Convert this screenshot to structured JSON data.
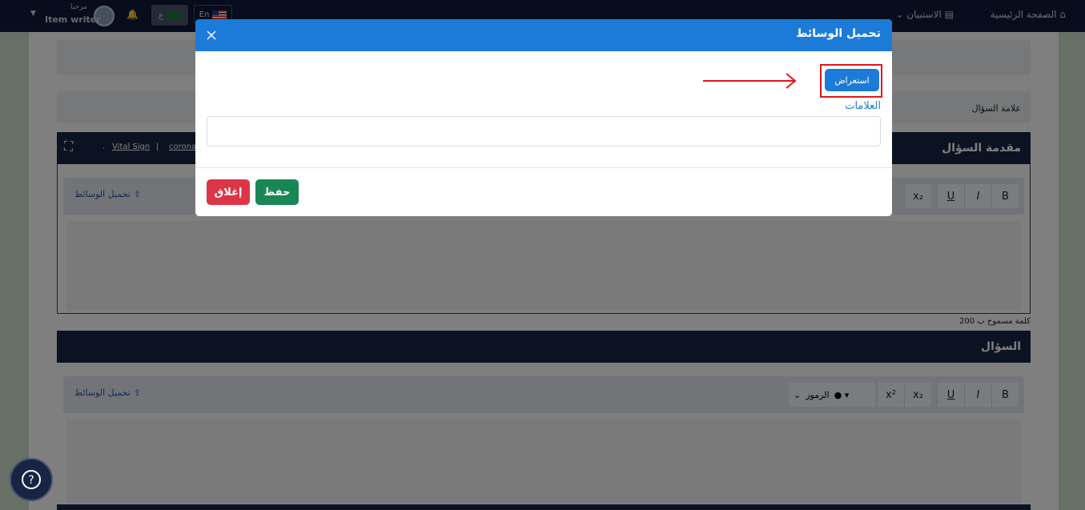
{
  "topbar": {
    "home_label": "الصفحة الرئيسية",
    "surveys_label": "الاستبيان",
    "lang_en": "En",
    "lang_ar": "ع",
    "greeting": "مرحبا",
    "user_name": "Item writer"
  },
  "page": {
    "question_mark_label": "علامة السؤال",
    "intro_panel_title": "مقدمة السؤال",
    "intro_links": [
      "Vital Sign",
      "corona"
    ],
    "intro_link_separator": "|",
    "intro_dot": ".",
    "upload_media_label": "تحميل الوسائط",
    "word_limit_text": "200 كلمة مسموح ب",
    "question_panel_title": "السؤال",
    "symbols_label": "الرموز",
    "toolbar_buttons": [
      "B",
      "I",
      "U",
      "x₂",
      "x²"
    ]
  },
  "modal": {
    "title": "تحميل الوسائط",
    "preview_button": "استعراض",
    "tags_label": "العلامات",
    "tags_value": "",
    "save_button": "حفظ",
    "close_button": "إغلاق"
  },
  "colors": {
    "primary": "#1c7bd8",
    "success": "#198754",
    "danger": "#dc3545",
    "navy": "#172444",
    "highlight": "#e0161b"
  }
}
